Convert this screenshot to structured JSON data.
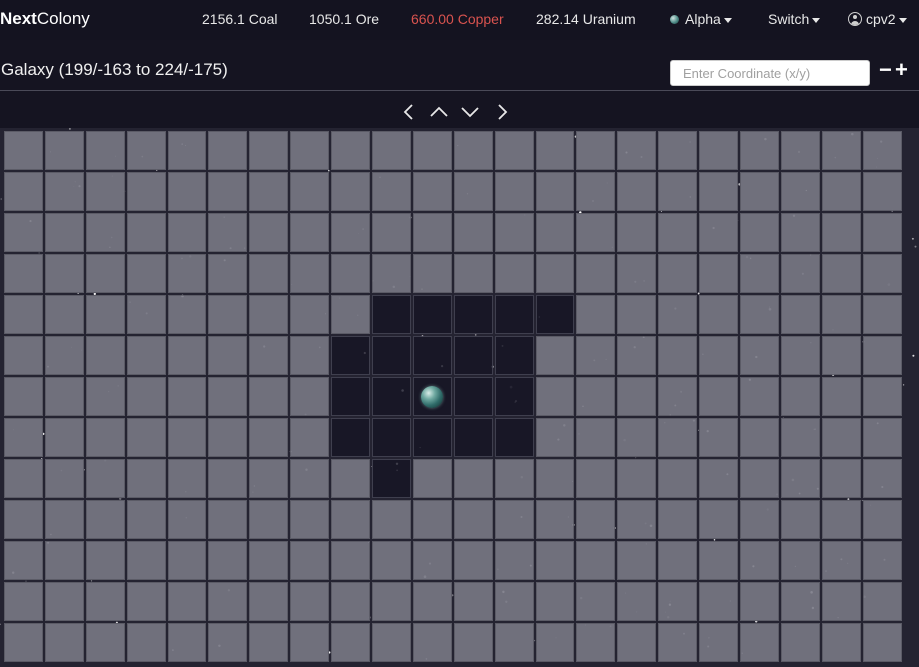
{
  "brand": {
    "part1": "Next",
    "part2": "Colony"
  },
  "resources": [
    {
      "label": "2156.1 Coal",
      "color": "#e8e8e8"
    },
    {
      "label": "1050.1 Ore",
      "color": "#e8e8e8"
    },
    {
      "label": "660.00 Copper",
      "color": "#d9534f"
    },
    {
      "label": "282.14 Uranium",
      "color": "#e8e8e8"
    }
  ],
  "nav": {
    "planet_label": "Alpha",
    "switch_label": "Switch",
    "user_label": "cpv2"
  },
  "galaxy": {
    "title": "Galaxy (199/-163 to 224/-175)",
    "coordinate_placeholder": "Enter Coordinate (x/y)",
    "zoom_out": "−",
    "zoom_in": "+"
  },
  "icons": {
    "left": "chevron-left-icon",
    "up": "chevron-up-icon",
    "down": "chevron-down-icon",
    "right": "chevron-right-icon"
  },
  "grid": {
    "columns": 22,
    "rows": 13,
    "explored_cells": [
      [
        4,
        9
      ],
      [
        4,
        10
      ],
      [
        4,
        11
      ],
      [
        4,
        12
      ],
      [
        4,
        13
      ],
      [
        5,
        8
      ],
      [
        5,
        9
      ],
      [
        5,
        10
      ],
      [
        5,
        11
      ],
      [
        5,
        12
      ],
      [
        6,
        8
      ],
      [
        6,
        9
      ],
      [
        6,
        10
      ],
      [
        6,
        11
      ],
      [
        6,
        12
      ],
      [
        7,
        8
      ],
      [
        7,
        9
      ],
      [
        7,
        10
      ],
      [
        7,
        11
      ],
      [
        7,
        12
      ],
      [
        8,
        9
      ]
    ],
    "planet_cells": [
      [
        6,
        10
      ]
    ]
  }
}
